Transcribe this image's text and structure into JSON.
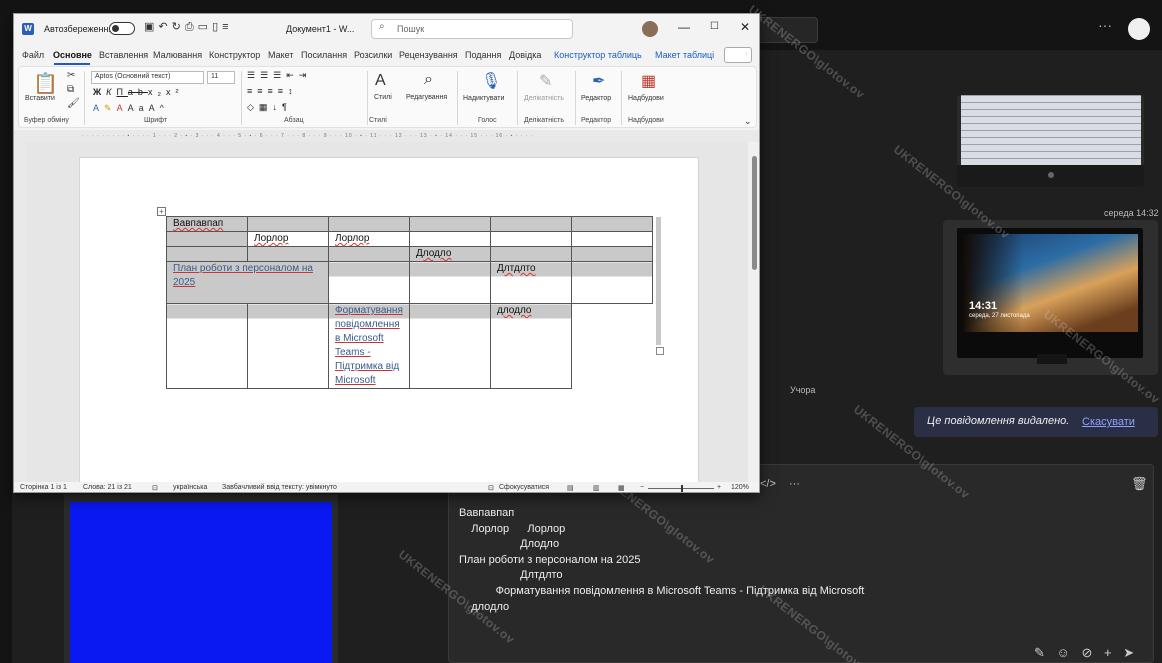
{
  "word": {
    "logo": "W",
    "autosave_label": "Автозбереження",
    "doc_title": "Документ1 - W...",
    "search_placeholder": "Пошук",
    "tabs": [
      "Файл",
      "Основне",
      "Вставлення",
      "Малювання",
      "Конструктор",
      "Макет",
      "Посилання",
      "Розсилки",
      "Рецензування",
      "Подання",
      "Довідка",
      "Конструктор таблиць",
      "Макет таблиці"
    ],
    "ribbon": {
      "paste": "Вставити",
      "clipboard": "Буфер обміну",
      "font_name": "Aptos (Основний текст)",
      "font_size": "11",
      "font_group": "Шрифт",
      "paragraph_group": "Абзац",
      "styles": "Стилі",
      "styles_group": "Стилі",
      "editing": "Редагування",
      "dictate": "Надиктувати",
      "voice_group": "Голос",
      "sensitivity": "Делікатність",
      "sensitivity_group": "Делікатність",
      "editor": "Редактор",
      "editor_group": "Редактор",
      "addins": "Надбудови",
      "addins_group": "Надбудови"
    },
    "table": {
      "r1c1": "Вавпавпап",
      "r2c2": "Лорлор",
      "r2c3": "Лорлор",
      "r3c4": "Длодло",
      "r4c1": "План роботи з персоналом на 2025",
      "r4c5": "Длтдлто",
      "r5c3": "Форматування повідомлення в Microsoft Teams - Підтримка від Microsoft",
      "r5c6": "длодло"
    },
    "status": {
      "page": "Сторінка 1 із 1",
      "words": "Слова: 21 із 21",
      "language": "українська",
      "predictive": "Завбачливий ввід тексту: увімкнуто",
      "focus": "Сфокусуватися",
      "zoom": "120%"
    }
  },
  "teams": {
    "timestamp": "середа 14:32",
    "yesterday": "Учора",
    "deleted_message": "Це повідомлення видалено.",
    "undo": "Скасувати",
    "clock_time": "14:31",
    "clock_date": "середа, 27 листопада",
    "compose_lines": [
      "Вавпавпап",
      "    Лорлор      Лорлор",
      "                    Длодло",
      "План роботи з персоналом на 2025",
      "                    Длтдлто",
      "            Форматування повідомлення в Microsoft Teams - Підтримка від Microsoft",
      "    длодло"
    ]
  },
  "watermark": "UKRENERGO\\glotov.ov"
}
